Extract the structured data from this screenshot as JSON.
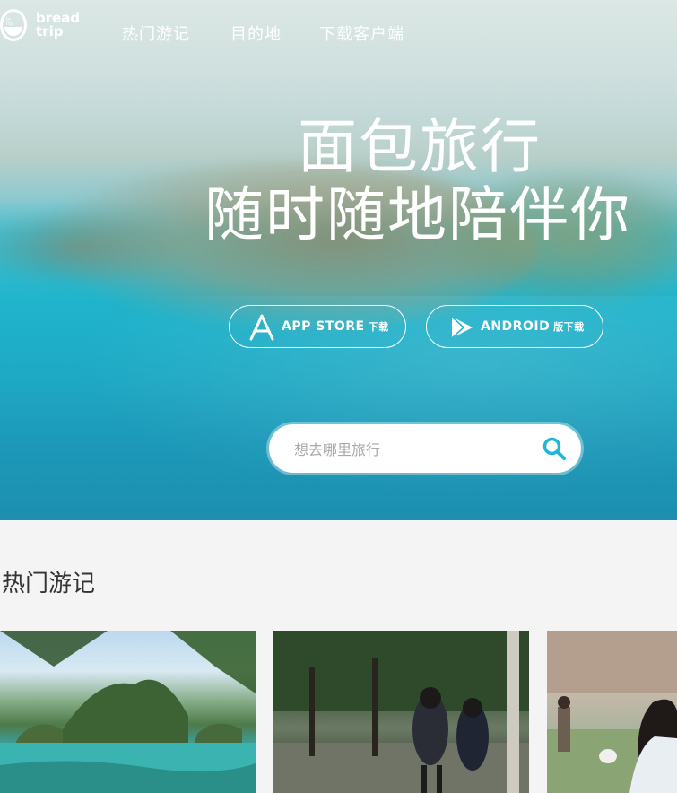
{
  "nav": {
    "logo_text_line1": "bread",
    "logo_text_line2": "trip",
    "links": [
      "热门游记",
      "目的地",
      "下载客户端"
    ]
  },
  "hero": {
    "line1": "面包旅行",
    "line2": "随时随地陪伴你",
    "appstore": {
      "label": "APP STORE",
      "suffix": "下载"
    },
    "android": {
      "label": "ANDROID",
      "suffix": "版下载"
    },
    "search": {
      "placeholder": "想去哪里旅行"
    }
  },
  "section": {
    "title": "热门游记"
  },
  "colors": {
    "accent": "#1fb7d6",
    "text_dark": "#333333"
  }
}
